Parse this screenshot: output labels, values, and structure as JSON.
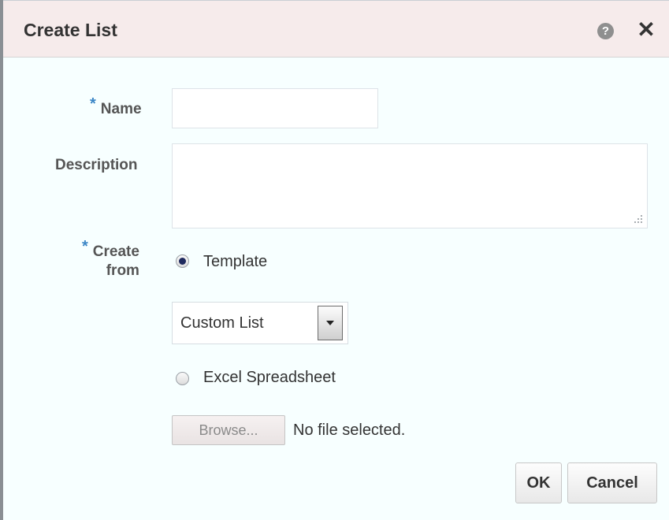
{
  "dialog": {
    "title": "Create List",
    "help_icon": "question-mark-icon",
    "help_glyph": "?",
    "close_icon": "close-x-icon",
    "close_glyph": "✕"
  },
  "form": {
    "required_marker": "*",
    "name": {
      "label": "Name",
      "value": "",
      "required": true
    },
    "description": {
      "label": "Description",
      "value": ""
    },
    "create_from": {
      "label_line1": "Create",
      "label_line2": "from",
      "required": true,
      "options": [
        {
          "label": "Template",
          "selected": true
        },
        {
          "label": "Excel Spreadsheet",
          "selected": false
        }
      ],
      "template_select": {
        "value": "Custom List"
      },
      "browse_label": "Browse...",
      "file_status": "No file selected."
    }
  },
  "actions": {
    "ok_label": "OK",
    "cancel_label": "Cancel"
  },
  "colors": {
    "title_bar_bg": "#f6ebeb",
    "dialog_bg": "#f7ffff",
    "required_marker": "#3b86c6",
    "label_text": "#555555"
  }
}
